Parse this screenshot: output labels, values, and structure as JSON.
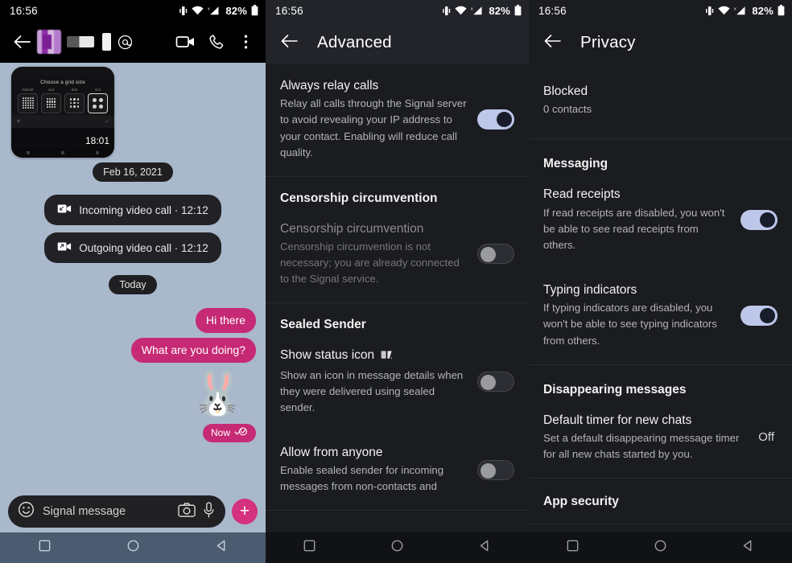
{
  "status_bar": {
    "time": "16:56",
    "battery_pct": "82%",
    "icons": [
      "vibrate-icon",
      "wifi-icon",
      "cellular-signal-icon",
      "battery-icon"
    ]
  },
  "chat_panel": {
    "header": {
      "back_icon": "back-arrow-icon",
      "contact_name_redacted": "",
      "mention_icon": "mention-icon",
      "video_call_icon": "video-call-icon",
      "voice_call_icon": "phone-icon",
      "overflow_icon": "more-vertical-icon"
    },
    "attachment_thumbnail": {
      "title": "Choose a grid size",
      "options": [
        "Default",
        "4x4",
        "5x5",
        "2x2"
      ],
      "selected_option": "2x2",
      "timestamp": "18:01"
    },
    "messages": [
      {
        "type": "date_separator",
        "text": "Feb 16, 2021"
      },
      {
        "type": "call",
        "icon": "incoming-video-call-icon",
        "text": "Incoming video call · 12:12"
      },
      {
        "type": "call",
        "icon": "outgoing-video-call-icon",
        "text": "Outgoing video call · 12:12"
      },
      {
        "type": "date_separator",
        "text": "Today"
      },
      {
        "type": "outgoing",
        "text": "Hi there"
      },
      {
        "type": "outgoing",
        "text": "What are you doing?"
      },
      {
        "type": "sticker",
        "text": "🐰"
      },
      {
        "type": "status",
        "text": "Now",
        "receipt": "read-receipt-double-check-icon"
      }
    ],
    "composer": {
      "emoji_icon": "emoji-icon",
      "placeholder": "Signal message",
      "camera_icon": "camera-icon",
      "microphone_icon": "microphone-icon",
      "add_attachment_label": "+"
    },
    "accent_color": "#c62a74",
    "background_color": "#aab8cc"
  },
  "advanced_panel": {
    "title": "Advanced",
    "back_icon": "back-arrow-icon",
    "sections": [
      {
        "group_heading": "",
        "rows": [
          {
            "title": "Always relay calls",
            "subtitle": "Relay all calls through the Signal server to avoid revealing your IP address to your contact. Enabling will reduce call quality.",
            "control": "toggle",
            "state": "on",
            "disabled": false
          }
        ]
      },
      {
        "group_heading": "Censorship circumvention",
        "rows": [
          {
            "title": "Censorship circumvention",
            "subtitle": "Censorship circumvention is not necessary; you are already connected to the Signal service.",
            "control": "toggle",
            "state": "off",
            "disabled": true
          }
        ]
      },
      {
        "group_heading": "Sealed Sender",
        "rows": [
          {
            "title": "Show status icon",
            "title_glyph": "sealed-sender-icon",
            "subtitle": "Show an icon in message details when they were delivered using sealed sender.",
            "control": "toggle",
            "state": "off",
            "disabled": false
          },
          {
            "title": "Allow from anyone",
            "subtitle": "Enable sealed sender for incoming messages from non-contacts and",
            "control": "toggle",
            "state": "off",
            "disabled": false
          }
        ]
      }
    ]
  },
  "privacy_panel": {
    "title": "Privacy",
    "back_icon": "back-arrow-icon",
    "sections": [
      {
        "group_heading": "",
        "rows": [
          {
            "title": "Blocked",
            "subtitle": "0 contacts",
            "control": "none"
          }
        ]
      },
      {
        "group_heading": "Messaging",
        "rows": [
          {
            "title": "Read receipts",
            "subtitle": "If read receipts are disabled, you won't be able to see read receipts from others.",
            "control": "toggle",
            "state": "on"
          },
          {
            "title": "Typing indicators",
            "subtitle": "If typing indicators are disabled, you won't be able to see typing indicators from others.",
            "control": "toggle",
            "state": "on"
          }
        ]
      },
      {
        "group_heading": "Disappearing messages",
        "rows": [
          {
            "title": "Default timer for new chats",
            "subtitle": "Set a default disappearing message timer for all new chats started by you.",
            "control": "value",
            "value": "Off"
          }
        ]
      },
      {
        "group_heading": "App security",
        "rows": []
      }
    ]
  },
  "nav_bar": {
    "recents_icon": "square-recents-icon",
    "home_icon": "circle-home-icon",
    "back_icon": "triangle-back-icon"
  }
}
